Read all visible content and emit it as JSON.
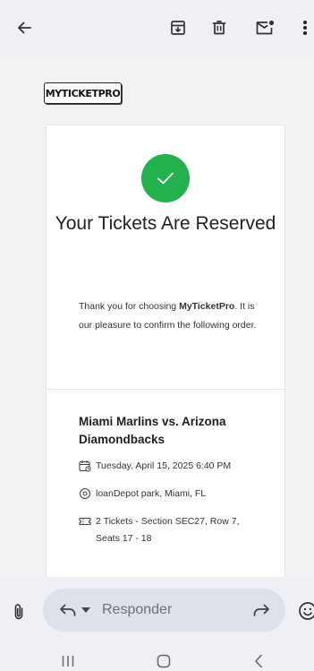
{
  "toolbar": {
    "icons": [
      "back-arrow-icon",
      "archive-icon",
      "delete-icon",
      "mark-unread-icon",
      "more-vert-icon"
    ]
  },
  "email": {
    "logo_text": "MYTICKETPRO",
    "heading": "Your Tickets Are Reserved",
    "intro_prefix": "Thank you for choosing ",
    "intro_brand": "MyTicketPro",
    "intro_suffix": ". It is our pleasure to confirm the following order.",
    "event_title": "Miami Marlins vs. Arizona Diamondbacks",
    "date": "Tuesday, April 15, 2025 6:40 PM",
    "venue": "loanDepot park, Miami, FL",
    "tickets": "2 Tickets - Section SEC27, Row 7, Seats 17 - 18"
  },
  "reply_bar": {
    "placeholder": "Responder"
  },
  "colors": {
    "success": "#22b14c",
    "bar_bg": "#eef0f5"
  }
}
